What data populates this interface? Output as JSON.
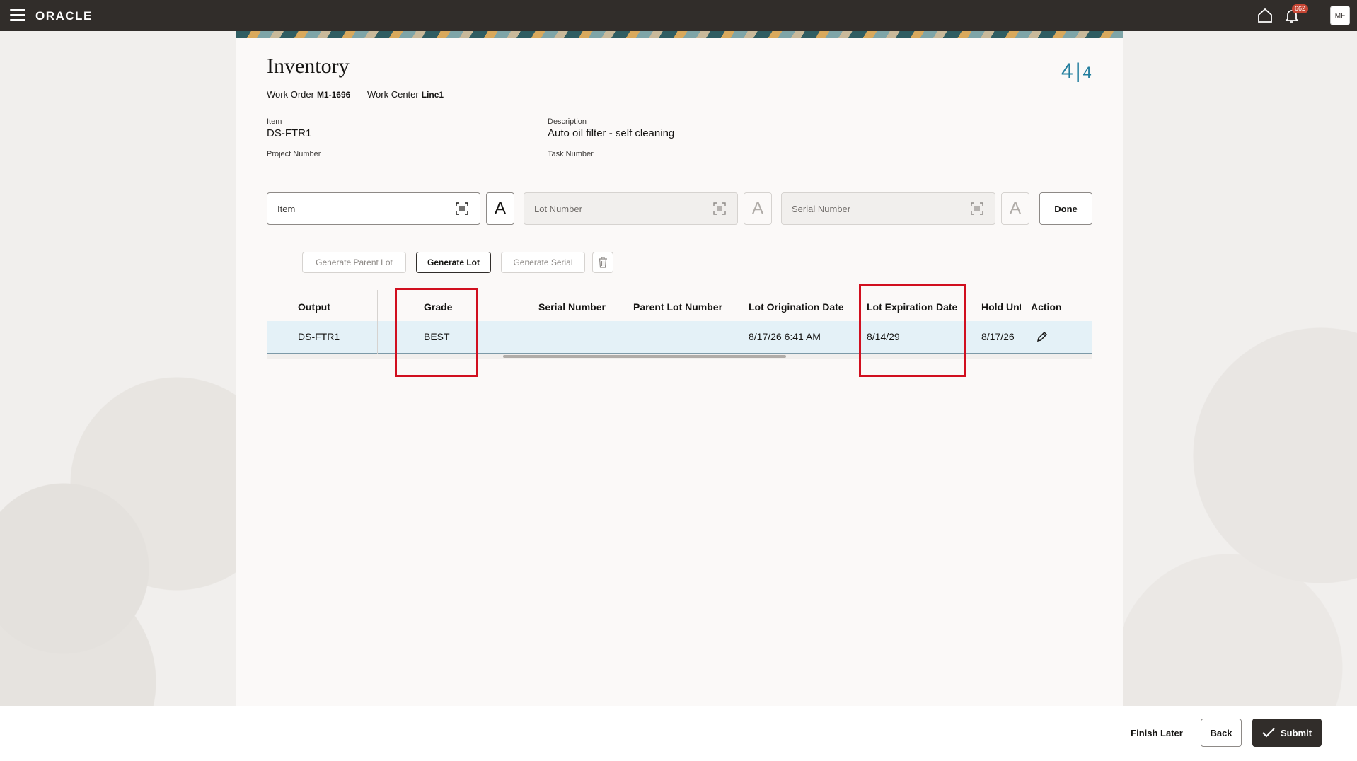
{
  "app": {
    "brand": "ORACLE",
    "notification_count": "662",
    "user_initials": "MF"
  },
  "page": {
    "title": "Inventory",
    "step_current": "4",
    "step_total": "4",
    "work_order_label": "Work Order",
    "work_order_value": "M1-1696",
    "work_center_label": "Work Center",
    "work_center_value": "Line1",
    "item_label": "Item",
    "item_value": "DS-FTR1",
    "description_label": "Description",
    "description_value": "Auto oil filter - self cleaning",
    "project_number_label": "Project Number",
    "task_number_label": "Task Number"
  },
  "inputs": {
    "item_placeholder": "Item",
    "lot_placeholder": "Lot Number",
    "serial_placeholder": "Serial Number",
    "done_label": "Done"
  },
  "actions": {
    "generate_parent_lot": "Generate Parent Lot",
    "generate_lot": "Generate Lot",
    "generate_serial": "Generate Serial"
  },
  "table": {
    "columns": [
      "Output",
      "Grade",
      "Serial Number",
      "Parent Lot Number",
      "Lot Origination Date",
      "Lot Expiration Date",
      "Hold Until Date",
      "Action"
    ],
    "rows": [
      {
        "output": "DS-FTR1",
        "grade": "BEST",
        "serial_number": "",
        "parent_lot_number": "",
        "lot_origination_date": "8/17/26 6:41 AM",
        "lot_expiration_date": "8/14/29",
        "hold_until_date": "8/17/26"
      }
    ]
  },
  "footer": {
    "finish_later": "Finish Later",
    "back": "Back",
    "submit": "Submit"
  },
  "colors": {
    "topbar": "#312d2a",
    "accent": "#227e9e",
    "highlight": "#d10f1f",
    "row_selected": "#e4f1f7"
  },
  "icons": [
    "menu-icon",
    "home-icon",
    "bell-icon",
    "barcode-scan-icon",
    "font-toggle-icon",
    "trash-icon",
    "pencil-icon",
    "check-icon"
  ]
}
